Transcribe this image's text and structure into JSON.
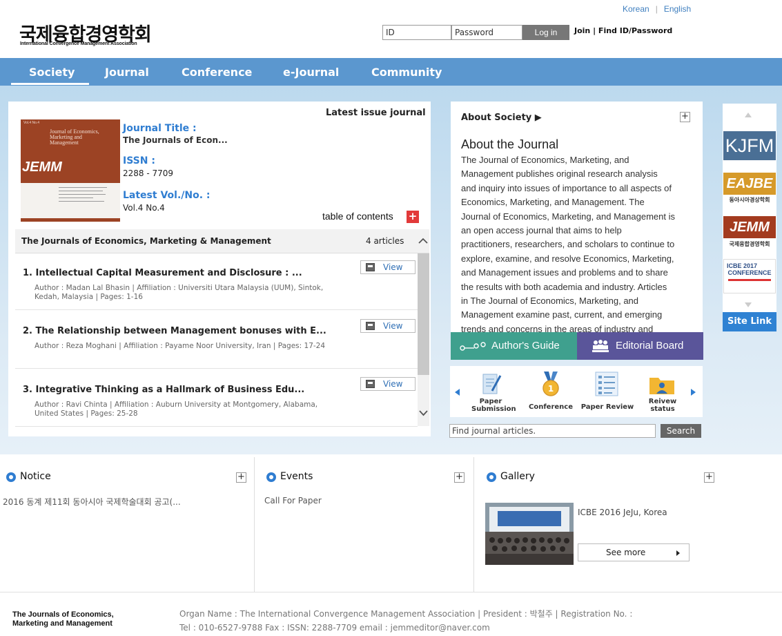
{
  "header": {
    "lang_korean": "Korean",
    "lang_sep": "|",
    "lang_english": "English",
    "logo_ko": "국제융합경영학회",
    "logo_en": "International Convergence Management Association",
    "id_placeholder": "ID",
    "pw_placeholder": "Password",
    "login_label": "Log in",
    "join_find": "Join | Find ID/Password"
  },
  "nav": {
    "society": "Society",
    "journal": "Journal",
    "conference": "Conference",
    "ejournal": "e-Journal",
    "community": "Community"
  },
  "journal": {
    "latest_issue_label": "Latest issue journal",
    "title_label": "Journal Title :",
    "title_value": "The Journals of Econ...",
    "issn_label": "ISSN :",
    "issn_value": "2288 - 7709",
    "volno_label": "Latest Vol./No. :",
    "volno_value": "Vol.4  No.4",
    "toc_label": "table of contents",
    "cover_title": "Journal of Economics, Marketing and Management",
    "cover_logo": "JEMM"
  },
  "articles": {
    "header": "The Journals of Economics, Marketing & Management",
    "count": "4 articles",
    "view_label": "View",
    "items": [
      {
        "title": "1. Intellectual Capital Measurement and Disclosure : ...",
        "meta1": "Author : Madan Lal Bhasin | Affiliation : Universiti Utara Malaysia (UUM), Sintok,",
        "meta2": "Kedah, Malaysia | Pages: 1-16"
      },
      {
        "title": "2. The Relationship between Management bonuses with E...",
        "meta1": "Author : Reza Moghani | Affiliation : Payame Noor University, Iran | Pages: 17-24",
        "meta2": ""
      },
      {
        "title": "3. Integrative Thinking as a Hallmark of Business Edu...",
        "meta1": "Author : Ravi Chinta | Affiliation : Auburn University at Montgomery, Alabama,",
        "meta2": "United States | Pages: 25-28"
      }
    ]
  },
  "about": {
    "header": "About Society ▶",
    "plus": "+",
    "title": "About the Journal",
    "lines": [
      "The Journal of Economics, Marketing, and",
      "Management publishes original research analysis",
      "and inquiry into issues of importance to all aspects of",
      "Economics, Marketing, and Management. The",
      "Journal of Economics, Marketing, and Management is",
      "an open access journal that aims to help",
      "practitioners, researchers, and scholars to continue to",
      "explore, examine, and resolve Economics, Marketing,",
      "and Management issues and problems and to share",
      "the results with both academia and industry. Articles",
      "in The Journal of Economics, Marketing, and",
      "Management examine past, current, and emerging",
      "trends and concerns in the areas of industry and"
    ],
    "authors_guide": "Author's Guide",
    "editorial_board": "Editorial Board"
  },
  "quick": {
    "paper_submission_1": "Paper",
    "paper_submission_2": "Submission",
    "conference": "Conference",
    "paper_review": "Paper Review",
    "review_status_1": "Reivew",
    "review_status_2": "status"
  },
  "search": {
    "placeholder": "Find journal articles.",
    "button": "Search"
  },
  "sitelinks": {
    "kjfm": "KJFM",
    "eajbe": "EAJBE",
    "eajbe_ko": "동아시아경상학회",
    "jemm": "JEMM",
    "jemm_ko": "국제융합경영학회",
    "icbe_1": "ICBE 2017",
    "icbe_2": "CONFERENCE",
    "label": "Site Link"
  },
  "bottom": {
    "notice_title": "Notice",
    "notice_item": "2016 동계 제11회 동아시아 국제학술대회 공고(...",
    "events_title": "Events",
    "events_item": "Call For Paper",
    "gallery_title": "Gallery",
    "gallery_caption": "ICBE 2016 JeJu, Korea",
    "see_more": "See more",
    "plus": "+"
  },
  "footer": {
    "logo_1": "The Journals of Economics,",
    "logo_2": "Marketing and Management",
    "line1": "Organ Name : The International Convergence Management Association | President : 박철주 | Registration No. :",
    "line2": "Tel : 010-6527-9788 Fax : ISSN: 2288-7709 email : jemmeditor@naver.com"
  },
  "colors": {
    "nav_bg": "#5b97cf",
    "accent_blue": "#2f7dd1",
    "guide_green": "#3fa08e",
    "board_purple": "#5a559a",
    "toc_red": "#e23a3a"
  }
}
